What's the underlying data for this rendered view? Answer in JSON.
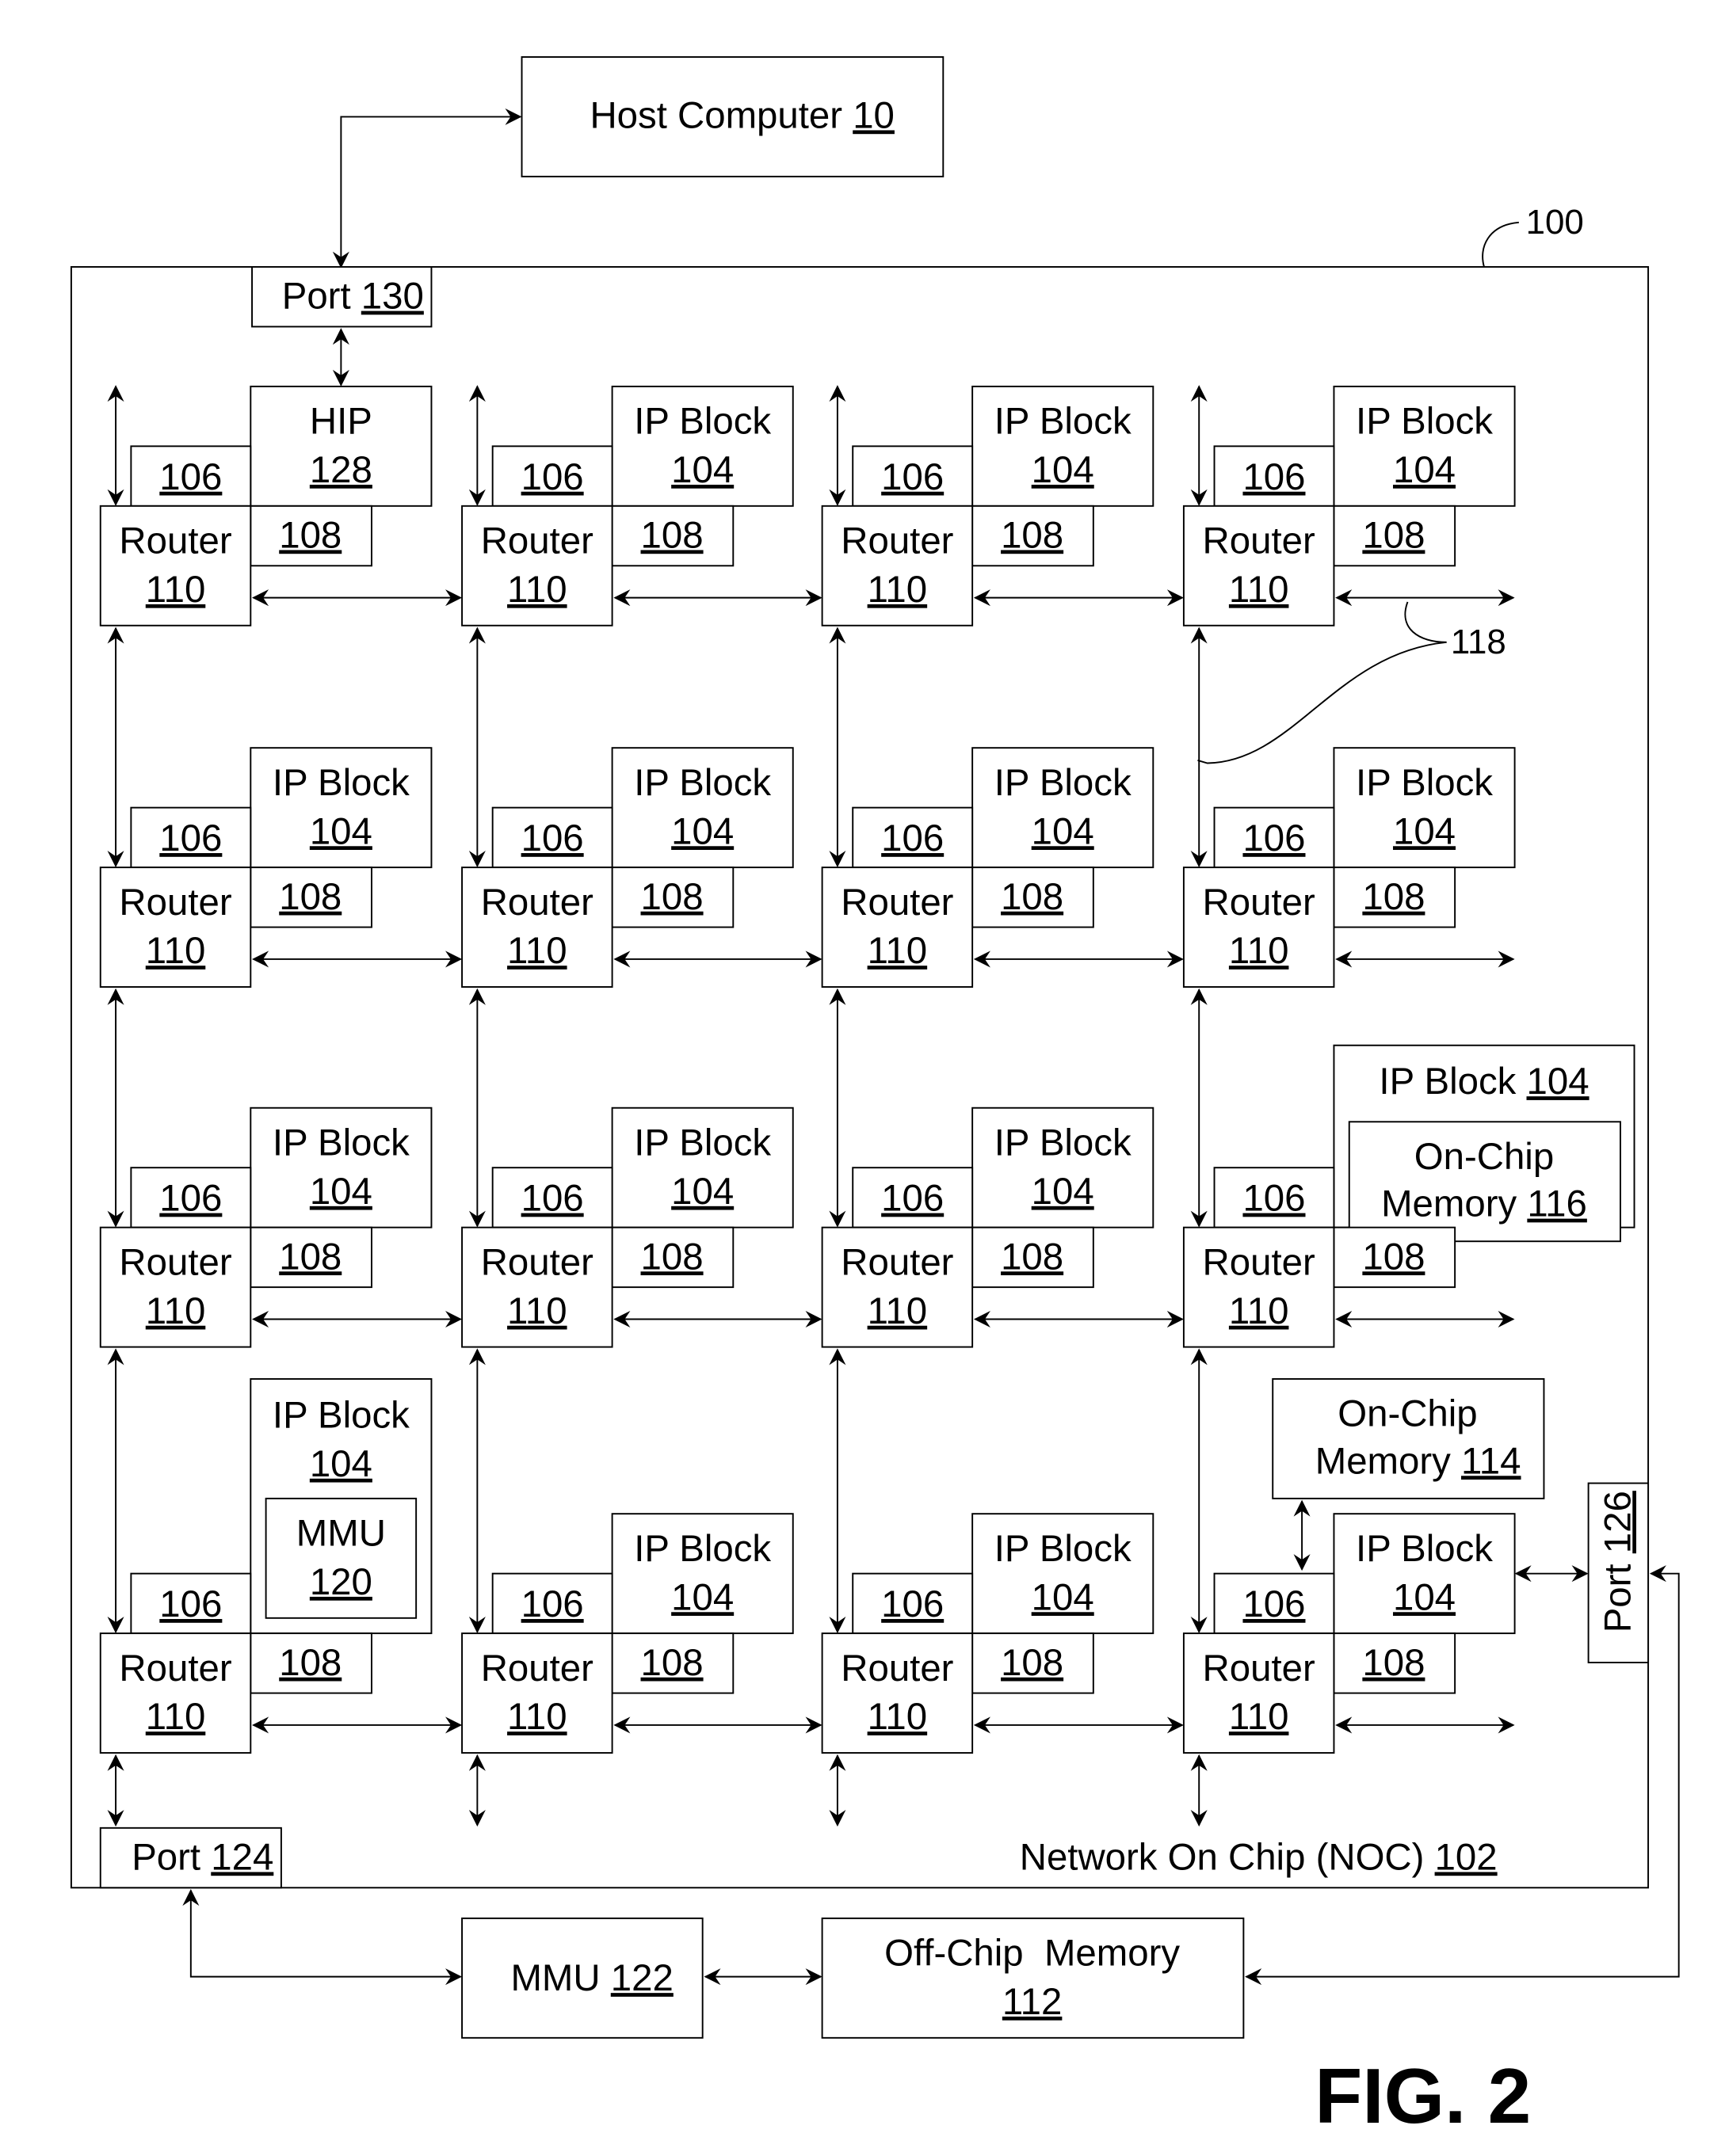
{
  "figure_label": "FIG. 2",
  "system_ref": "100",
  "link_ref": "118",
  "host": {
    "label": "Host Computer ",
    "ref": "10"
  },
  "port_130": {
    "label": "Port ",
    "ref": "130"
  },
  "port_124": {
    "label": "Port ",
    "ref": "124"
  },
  "port_126": {
    "label": "Port ",
    "ref": "126"
  },
  "noc": {
    "label": "Network On Chip (NOC) ",
    "ref": "102"
  },
  "mmu_122": {
    "label": "MMU ",
    "ref": "122"
  },
  "off_chip_memory": {
    "line1": "Off-Chip  Memory",
    "ref": "112"
  },
  "on_chip_memory_114": {
    "line1": "On-Chip",
    "line2": "Memory ",
    "ref": "114"
  },
  "on_chip_memory_116": {
    "line1": "On-Chip",
    "line2": "Memory ",
    "ref": "116"
  },
  "mmu_120": {
    "line1": "MMU",
    "ref": "120"
  },
  "hip": {
    "line1": "HIP",
    "ref": "128"
  },
  "ip_block": {
    "line1": "IP Block",
    "ref": "104",
    "inline_label": "IP Block "
  },
  "router": {
    "line1": "Router",
    "ref": "110"
  },
  "memory_interface_ref": "106",
  "network_interface_ref": "108",
  "grid": {
    "rows": 4,
    "cols": 4,
    "cells": [
      [
        "hip",
        "ip",
        "ip",
        "ip"
      ],
      [
        "ip",
        "ip",
        "ip",
        "ip"
      ],
      [
        "ip",
        "ip",
        "ip",
        "ip-onchip-116"
      ],
      [
        "ip-mmu-120",
        "ip",
        "ip",
        "ip-port-126"
      ]
    ]
  }
}
